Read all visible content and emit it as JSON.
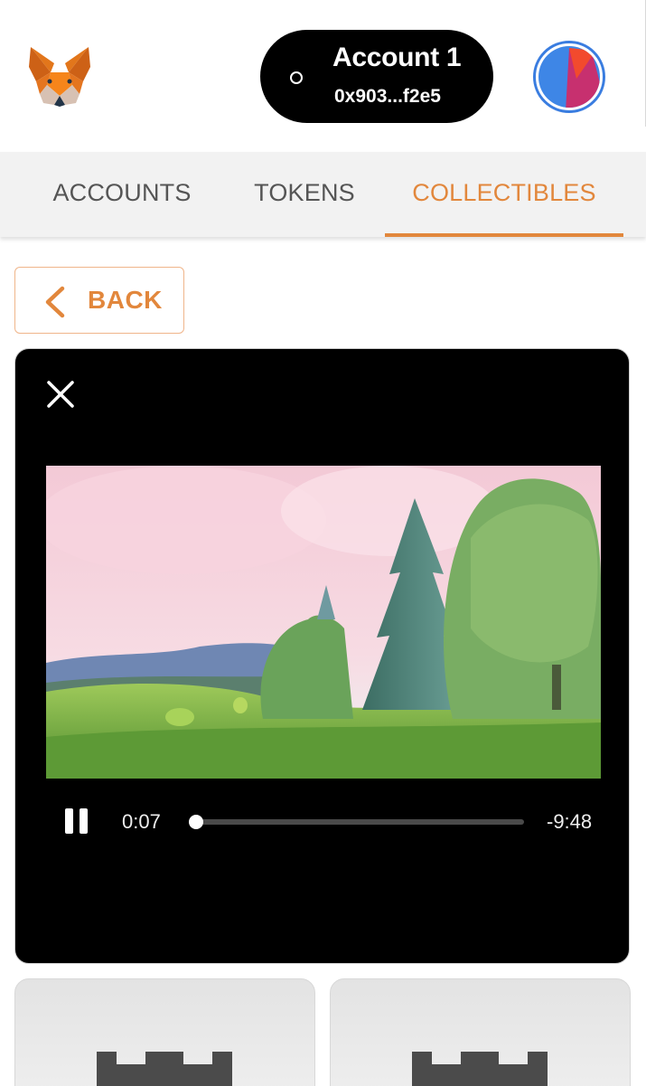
{
  "header": {
    "logo_icon": "metamask-fox-icon",
    "account": {
      "name": "Account 1",
      "address": "0x903...f2e5"
    },
    "avatar_icon": "account-identicon",
    "colors": {
      "pill": "#000000",
      "avatar_ring": "#3a7de0"
    }
  },
  "tabs": [
    {
      "label": "ACCOUNTS",
      "active": false
    },
    {
      "label": "TOKENS",
      "active": false
    },
    {
      "label": "COLLECTIBLES",
      "active": true
    }
  ],
  "back_button": {
    "label": "BACK",
    "icon": "chevron-left-icon"
  },
  "video_player": {
    "close_icon": "close-icon",
    "play_state_icon": "pause-icon",
    "current_time": "0:07",
    "remaining_time": "-9:48",
    "progress_fraction": 0.012
  },
  "collectible_thumbs": [
    {
      "icon": "castle-placeholder-icon"
    },
    {
      "icon": "castle-placeholder-icon"
    }
  ],
  "colors": {
    "accent": "#e2873c",
    "tab_text": "#555555",
    "tabs_bg": "#f2f2f2"
  }
}
